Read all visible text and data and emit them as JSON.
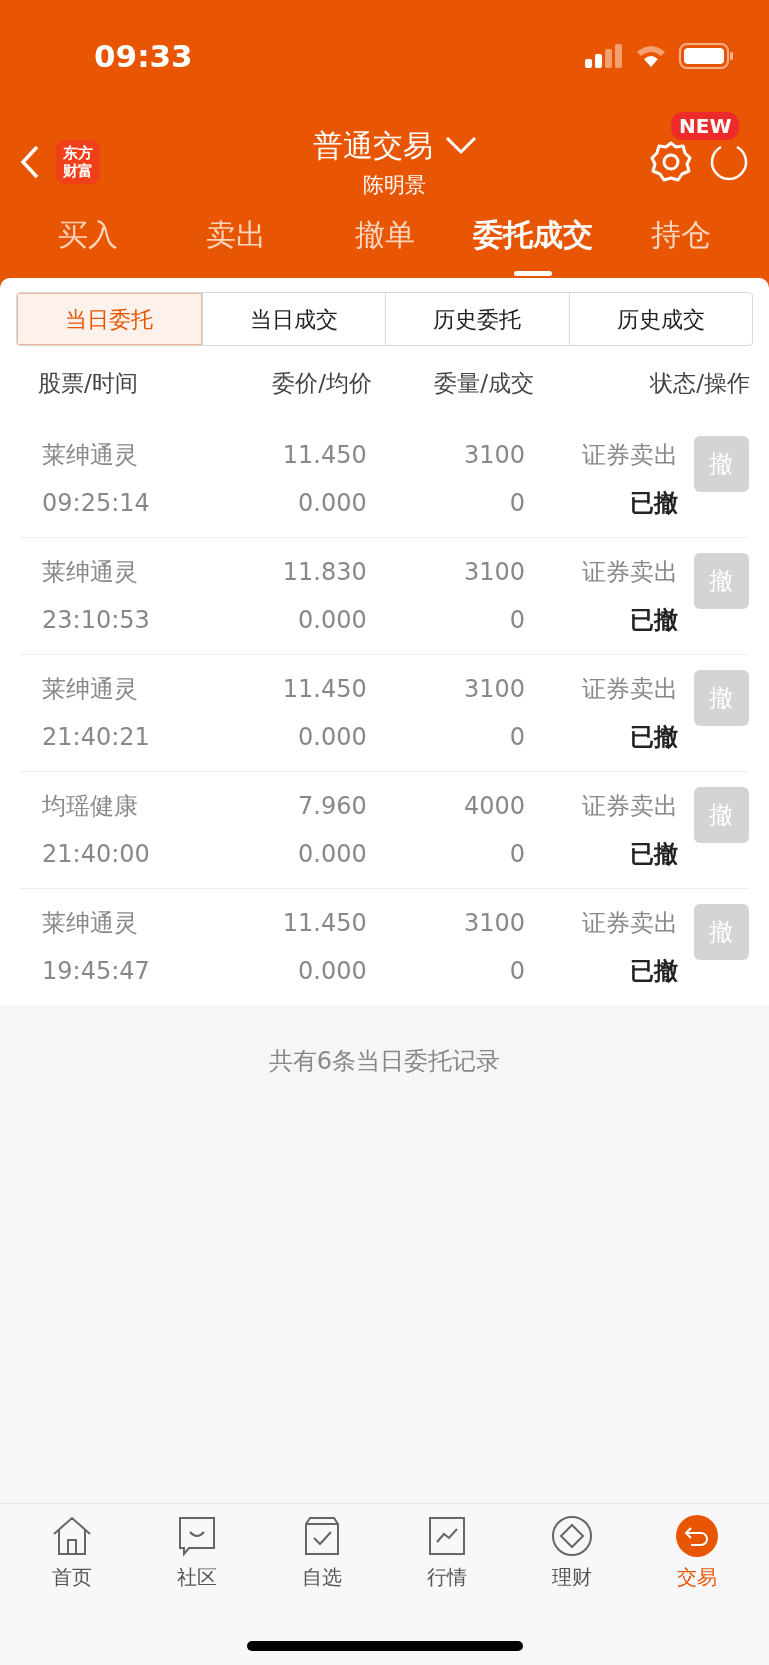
{
  "status_bar": {
    "time": "09:33"
  },
  "header": {
    "logo": "东方财富",
    "title": "普通交易",
    "subtitle": "陈明景",
    "badge": "NEW"
  },
  "tabs": [
    {
      "label": "买入",
      "selected": false
    },
    {
      "label": "卖出",
      "selected": false
    },
    {
      "label": "撤单",
      "selected": false
    },
    {
      "label": "委托成交",
      "selected": true
    },
    {
      "label": "持仓",
      "selected": false
    }
  ],
  "segments": [
    {
      "label": "当日委托",
      "selected": true
    },
    {
      "label": "当日成交",
      "selected": false
    },
    {
      "label": "历史委托",
      "selected": false
    },
    {
      "label": "历史成交",
      "selected": false
    }
  ],
  "table": {
    "columns": [
      "股票/时间",
      "委价/均价",
      "委量/成交",
      "状态/操作"
    ],
    "rows": [
      {
        "name": "莱绅通灵",
        "time": "09:25:14",
        "price": "11.450",
        "avg": "0.000",
        "qty": "3100",
        "filled": "0",
        "type": "证券卖出",
        "status": "已撤",
        "action": "撤"
      },
      {
        "name": "莱绅通灵",
        "time": "23:10:53",
        "price": "11.830",
        "avg": "0.000",
        "qty": "3100",
        "filled": "0",
        "type": "证券卖出",
        "status": "已撤",
        "action": "撤"
      },
      {
        "name": "莱绅通灵",
        "time": "21:40:21",
        "price": "11.450",
        "avg": "0.000",
        "qty": "3100",
        "filled": "0",
        "type": "证券卖出",
        "status": "已撤",
        "action": "撤"
      },
      {
        "name": "均瑶健康",
        "time": "21:40:00",
        "price": "7.960",
        "avg": "0.000",
        "qty": "4000",
        "filled": "0",
        "type": "证券卖出",
        "status": "已撤",
        "action": "撤"
      },
      {
        "name": "莱绅通灵",
        "time": "19:45:47",
        "price": "11.450",
        "avg": "0.000",
        "qty": "3100",
        "filled": "0",
        "type": "证券卖出",
        "status": "已撤",
        "action": "撤"
      }
    ]
  },
  "footer_note": "共有6条当日委托记录",
  "bottom_nav": [
    {
      "label": "首页",
      "selected": false
    },
    {
      "label": "社区",
      "selected": false
    },
    {
      "label": "自选",
      "selected": false
    },
    {
      "label": "行情",
      "selected": false
    },
    {
      "label": "理财",
      "selected": false
    },
    {
      "label": "交易",
      "selected": true
    }
  ]
}
